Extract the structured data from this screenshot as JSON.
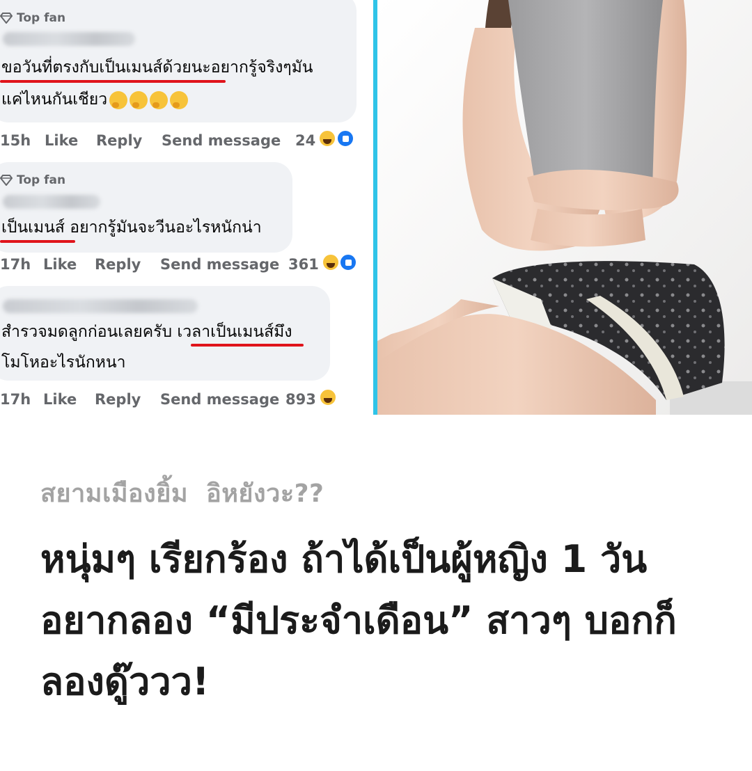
{
  "comments": [
    {
      "badge": "Top fan",
      "line1": "ขอวันที่ตรงกับเป็นเมนส์ด้วยนะอยากรู้จริงๆมัน",
      "line2": "แค่ไหนกันเชียว",
      "time": "15h",
      "like": "Like",
      "reply": "Reply",
      "send": "Send message",
      "count": "24"
    },
    {
      "badge": "Top fan",
      "line1": "เป็นเมนส์ อยากรู้มันจะวีนอะไรหนักน่า",
      "time": "17h",
      "like": "Like",
      "reply": "Reply",
      "send": "Send message",
      "count": "361"
    },
    {
      "line1": "สำรวจมดลูกก่อนเลยครับ เวลาเป็นเมนส์มึง",
      "line2": "โมโหอะไรนักหนา",
      "time": "17h",
      "like": "Like",
      "reply": "Reply",
      "send": "Send message",
      "count": "893"
    }
  ],
  "article": {
    "source": "สยามเมืองยิ้ม",
    "tag": "อิหยังวะ??",
    "headline": "หนุ่มๆ เรียกร้อง ถ้าได้เป็นผู้หญิง 1 วัน อยากลอง “มีประจำเดือน” สาวๆ บอกก็ลองดู๊ววว!"
  },
  "colors": {
    "divider": "#2fc4e8",
    "underline": "#e0141b",
    "bubble": "#f0f2f5"
  }
}
